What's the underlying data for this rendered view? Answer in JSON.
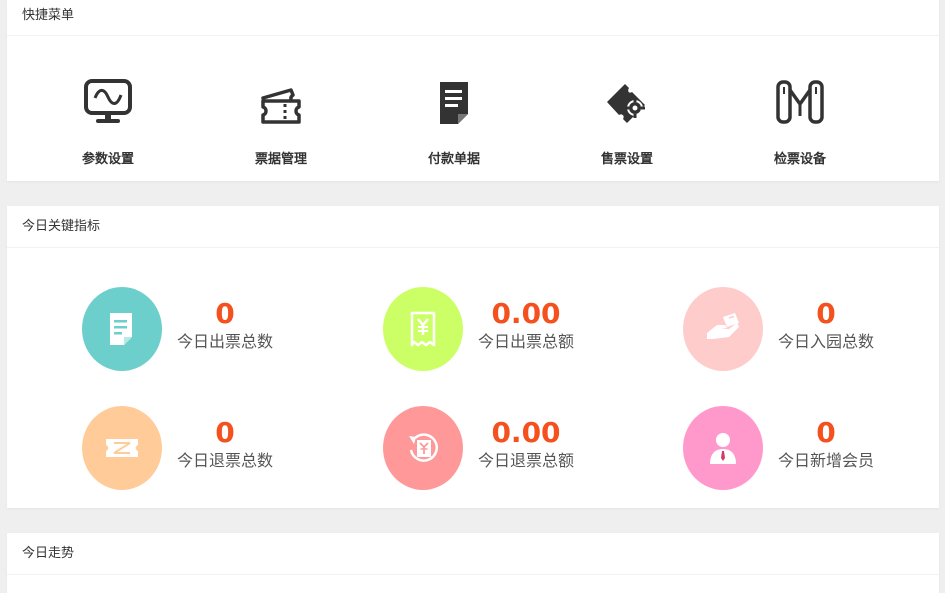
{
  "quick_menu": {
    "title": "快捷菜单",
    "items": [
      {
        "label": "参数设置",
        "icon": "monitor-settings-icon"
      },
      {
        "label": "票据管理",
        "icon": "ticket-icon"
      },
      {
        "label": "付款单据",
        "icon": "document-icon"
      },
      {
        "label": "售票设置",
        "icon": "ticket-gear-icon"
      },
      {
        "label": "检票设备",
        "icon": "turnstile-gate-icon"
      }
    ]
  },
  "metrics": {
    "title": "今日关键指标",
    "items": [
      {
        "value": "0",
        "label": "今日出票总数",
        "icon": "ticket-doc-icon",
        "color": "#6ccfcc"
      },
      {
        "value": "0.00",
        "label": "今日出票总额",
        "icon": "yuan-receipt-icon",
        "color": "#ccff66"
      },
      {
        "value": "0",
        "label": "今日入园总数",
        "icon": "hand-ticket-icon",
        "color": "#ffcccc"
      },
      {
        "value": "0",
        "label": "今日退票总数",
        "icon": "refund-ticket-icon",
        "color": "#ffcc99"
      },
      {
        "value": "0.00",
        "label": "今日退票总额",
        "icon": "refund-amount-icon",
        "color": "#ff9999"
      },
      {
        "value": "0",
        "label": "今日新增会员",
        "icon": "member-icon",
        "color": "#ff99cc"
      }
    ]
  },
  "trend": {
    "title": "今日走势"
  },
  "colors": {
    "value_text": "#f4511e",
    "icon_dark": "#333333",
    "background": "#efefef"
  }
}
